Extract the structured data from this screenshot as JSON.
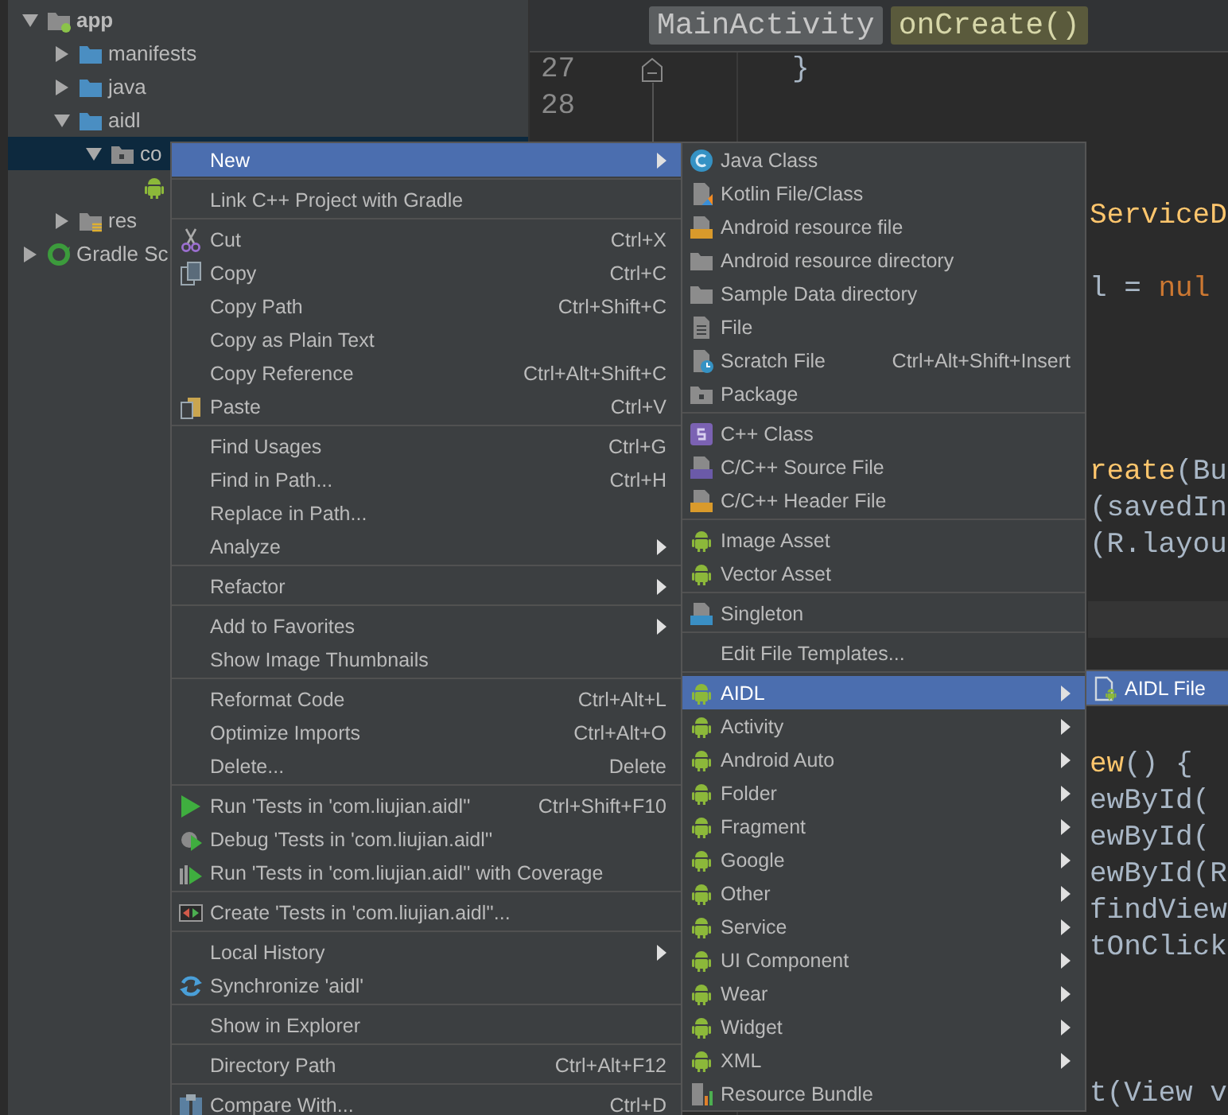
{
  "project_tree": {
    "items": [
      {
        "label": "app",
        "kind": "module",
        "expanded": true,
        "selected": false,
        "children": [
          {
            "label": "manifests",
            "kind": "folder",
            "expanded": false,
            "selected": false
          },
          {
            "label": "java",
            "kind": "folder",
            "expanded": false,
            "selected": false
          },
          {
            "label": "aidl",
            "kind": "folder",
            "expanded": true,
            "selected": false,
            "children": [
              {
                "label": "co",
                "kind": "package",
                "expanded": true,
                "selected": true,
                "children": [
                  {
                    "kind": "android",
                    "selected": false
                  }
                ]
              }
            ]
          },
          {
            "label": "res",
            "kind": "res-folder",
            "expanded": false,
            "selected": false
          }
        ]
      },
      {
        "label": "Gradle Sc",
        "kind": "gradle",
        "expanded": false,
        "selected": false
      }
    ]
  },
  "editor": {
    "breadcrumbs": [
      {
        "label": "MainActivity",
        "kind": "class"
      },
      {
        "label": "onCreate()",
        "kind": "method"
      }
    ],
    "line_numbers": [
      "27",
      "28"
    ],
    "lines": [
      {
        "kind": "code",
        "parts": [
          {
            "text": "}",
            "kind": "plain"
          }
        ]
      },
      {
        "kind": "blank"
      },
      {
        "kind": "blank"
      },
      {
        "kind": "blank"
      },
      {
        "kind": "fragment",
        "parts": [
          {
            "text": "ServiceD",
            "kind": "method"
          }
        ]
      },
      {
        "kind": "blank"
      },
      {
        "kind": "fragment",
        "parts": [
          {
            "text": "l = ",
            "kind": "plain"
          },
          {
            "text": "nul",
            "kind": "keyword"
          }
        ]
      },
      {
        "kind": "blank"
      },
      {
        "kind": "blank"
      },
      {
        "kind": "blank"
      },
      {
        "kind": "blank"
      },
      {
        "kind": "fragment",
        "parts": [
          {
            "text": "reate",
            "kind": "method"
          },
          {
            "text": "(Bu",
            "kind": "plain"
          }
        ]
      },
      {
        "kind": "fragment",
        "parts": [
          {
            "text": "(savedIn",
            "kind": "plain"
          }
        ]
      },
      {
        "kind": "fragment",
        "parts": [
          {
            "text": "(R.layou",
            "kind": "plain"
          }
        ]
      },
      {
        "kind": "blank"
      },
      {
        "kind": "current"
      },
      {
        "kind": "blank"
      },
      {
        "kind": "blank"
      },
      {
        "kind": "blank"
      },
      {
        "kind": "fragment",
        "parts": [
          {
            "text": "ew",
            "kind": "method"
          },
          {
            "text": "() {",
            "kind": "plain"
          }
        ]
      },
      {
        "kind": "fragment",
        "parts": [
          {
            "text": "ewById(",
            "kind": "plain"
          }
        ]
      },
      {
        "kind": "fragment",
        "parts": [
          {
            "text": "ewById(",
            "kind": "plain"
          }
        ]
      },
      {
        "kind": "fragment",
        "parts": [
          {
            "text": "ewById(R",
            "kind": "plain"
          }
        ]
      },
      {
        "kind": "fragment",
        "parts": [
          {
            "text": "findView",
            "kind": "plain"
          }
        ]
      },
      {
        "kind": "fragment",
        "parts": [
          {
            "text": "tOnClick",
            "kind": "plain"
          }
        ]
      },
      {
        "kind": "blank"
      },
      {
        "kind": "blank"
      },
      {
        "kind": "blank"
      },
      {
        "kind": "fragment",
        "parts": [
          {
            "text": "t(View v",
            "kind": "plain"
          }
        ]
      }
    ]
  },
  "context_menu": {
    "items": [
      {
        "kind": "item",
        "label": "New",
        "submenu": true,
        "selected": true
      },
      {
        "kind": "separator"
      },
      {
        "kind": "item",
        "label": "Link C++ Project with Gradle",
        "submenu": false,
        "selected": false
      },
      {
        "kind": "separator"
      },
      {
        "kind": "item",
        "label": "Cut",
        "shortcut": "Ctrl+X",
        "submenu": false,
        "selected": false
      },
      {
        "kind": "item",
        "label": "Copy",
        "shortcut": "Ctrl+C",
        "submenu": false,
        "selected": false
      },
      {
        "kind": "item",
        "label": "Copy Path",
        "shortcut": "Ctrl+Shift+C",
        "submenu": false,
        "selected": false
      },
      {
        "kind": "item",
        "label": "Copy as Plain Text",
        "submenu": false,
        "selected": false
      },
      {
        "kind": "item",
        "label": "Copy Reference",
        "shortcut": "Ctrl+Alt+Shift+C",
        "submenu": false,
        "selected": false
      },
      {
        "kind": "item",
        "label": "Paste",
        "shortcut": "Ctrl+V",
        "submenu": false,
        "selected": false
      },
      {
        "kind": "separator"
      },
      {
        "kind": "item",
        "label": "Find Usages",
        "shortcut": "Ctrl+G",
        "submenu": false,
        "selected": false
      },
      {
        "kind": "item",
        "label": "Find in Path...",
        "shortcut": "Ctrl+H",
        "submenu": false,
        "selected": false
      },
      {
        "kind": "item",
        "label": "Replace in Path...",
        "submenu": false,
        "selected": false
      },
      {
        "kind": "item",
        "label": "Analyze",
        "submenu": true,
        "selected": false
      },
      {
        "kind": "separator"
      },
      {
        "kind": "item",
        "label": "Refactor",
        "submenu": true,
        "selected": false
      },
      {
        "kind": "separator"
      },
      {
        "kind": "item",
        "label": "Add to Favorites",
        "submenu": true,
        "selected": false
      },
      {
        "kind": "item",
        "label": "Show Image Thumbnails",
        "submenu": false,
        "selected": false
      },
      {
        "kind": "separator"
      },
      {
        "kind": "item",
        "label": "Reformat Code",
        "shortcut": "Ctrl+Alt+L",
        "submenu": false,
        "selected": false
      },
      {
        "kind": "item",
        "label": "Optimize Imports",
        "shortcut": "Ctrl+Alt+O",
        "submenu": false,
        "selected": false
      },
      {
        "kind": "item",
        "label": "Delete...",
        "shortcut": "Delete",
        "submenu": false,
        "selected": false
      },
      {
        "kind": "separator"
      },
      {
        "kind": "item",
        "label": "Run 'Tests in 'com.liujian.aidl''",
        "shortcut": "Ctrl+Shift+F10",
        "submenu": false,
        "selected": false
      },
      {
        "kind": "item",
        "label": "Debug 'Tests in 'com.liujian.aidl''",
        "submenu": false,
        "selected": false
      },
      {
        "kind": "item",
        "label": "Run 'Tests in 'com.liujian.aidl'' with Coverage",
        "submenu": false,
        "selected": false
      },
      {
        "kind": "separator"
      },
      {
        "kind": "item",
        "label": "Create 'Tests in 'com.liujian.aidl''...",
        "submenu": false,
        "selected": false
      },
      {
        "kind": "separator"
      },
      {
        "kind": "item",
        "label": "Local History",
        "submenu": true,
        "selected": false
      },
      {
        "kind": "item",
        "label": "Synchronize 'aidl'",
        "submenu": false,
        "selected": false
      },
      {
        "kind": "separator"
      },
      {
        "kind": "item",
        "label": "Show in Explorer",
        "submenu": false,
        "selected": false
      },
      {
        "kind": "separator"
      },
      {
        "kind": "item",
        "label": "Directory Path",
        "shortcut": "Ctrl+Alt+F12",
        "submenu": false,
        "selected": false
      },
      {
        "kind": "separator"
      },
      {
        "kind": "item",
        "label": "Compare With...",
        "shortcut": "Ctrl+D",
        "submenu": false,
        "selected": false
      }
    ]
  },
  "new_submenu": {
    "items": [
      {
        "kind": "item",
        "label": "Java Class",
        "submenu": false,
        "selected": false
      },
      {
        "kind": "item",
        "label": "Kotlin File/Class",
        "submenu": false,
        "selected": false
      },
      {
        "kind": "item",
        "label": "Android resource file",
        "submenu": false,
        "selected": false
      },
      {
        "kind": "item",
        "label": "Android resource directory",
        "submenu": false,
        "selected": false
      },
      {
        "kind": "item",
        "label": "Sample Data directory",
        "submenu": false,
        "selected": false
      },
      {
        "kind": "item",
        "label": "File",
        "submenu": false,
        "selected": false
      },
      {
        "kind": "item",
        "label": "Scratch File",
        "shortcut": "Ctrl+Alt+Shift+Insert",
        "submenu": false,
        "selected": false
      },
      {
        "kind": "item",
        "label": "Package",
        "submenu": false,
        "selected": false
      },
      {
        "kind": "separator"
      },
      {
        "kind": "item",
        "label": "C++ Class",
        "submenu": false,
        "selected": false
      },
      {
        "kind": "item",
        "label": "C/C++ Source File",
        "submenu": false,
        "selected": false
      },
      {
        "kind": "item",
        "label": "C/C++ Header File",
        "submenu": false,
        "selected": false
      },
      {
        "kind": "separator"
      },
      {
        "kind": "item",
        "label": "Image Asset",
        "submenu": false,
        "selected": false
      },
      {
        "kind": "item",
        "label": "Vector Asset",
        "submenu": false,
        "selected": false
      },
      {
        "kind": "separator"
      },
      {
        "kind": "item",
        "label": "Singleton",
        "submenu": false,
        "selected": false
      },
      {
        "kind": "separator"
      },
      {
        "kind": "item",
        "label": "Edit File Templates...",
        "submenu": false,
        "selected": false
      },
      {
        "kind": "separator"
      },
      {
        "kind": "item",
        "label": "AIDL",
        "submenu": true,
        "selected": true
      },
      {
        "kind": "item",
        "label": "Activity",
        "submenu": true,
        "selected": false
      },
      {
        "kind": "item",
        "label": "Android Auto",
        "submenu": true,
        "selected": false
      },
      {
        "kind": "item",
        "label": "Folder",
        "submenu": true,
        "selected": false
      },
      {
        "kind": "item",
        "label": "Fragment",
        "submenu": true,
        "selected": false
      },
      {
        "kind": "item",
        "label": "Google",
        "submenu": true,
        "selected": false
      },
      {
        "kind": "item",
        "label": "Other",
        "submenu": true,
        "selected": false
      },
      {
        "kind": "item",
        "label": "Service",
        "submenu": true,
        "selected": false
      },
      {
        "kind": "item",
        "label": "UI Component",
        "submenu": true,
        "selected": false
      },
      {
        "kind": "item",
        "label": "Wear",
        "submenu": true,
        "selected": false
      },
      {
        "kind": "item",
        "label": "Widget",
        "submenu": true,
        "selected": false
      },
      {
        "kind": "item",
        "label": "XML",
        "submenu": true,
        "selected": false
      },
      {
        "kind": "item",
        "label": "Resource Bundle",
        "submenu": false,
        "selected": false
      }
    ]
  },
  "aidl_submenu": {
    "items": [
      {
        "kind": "item",
        "label": "AIDL File",
        "submenu": false,
        "selected": true
      }
    ]
  }
}
